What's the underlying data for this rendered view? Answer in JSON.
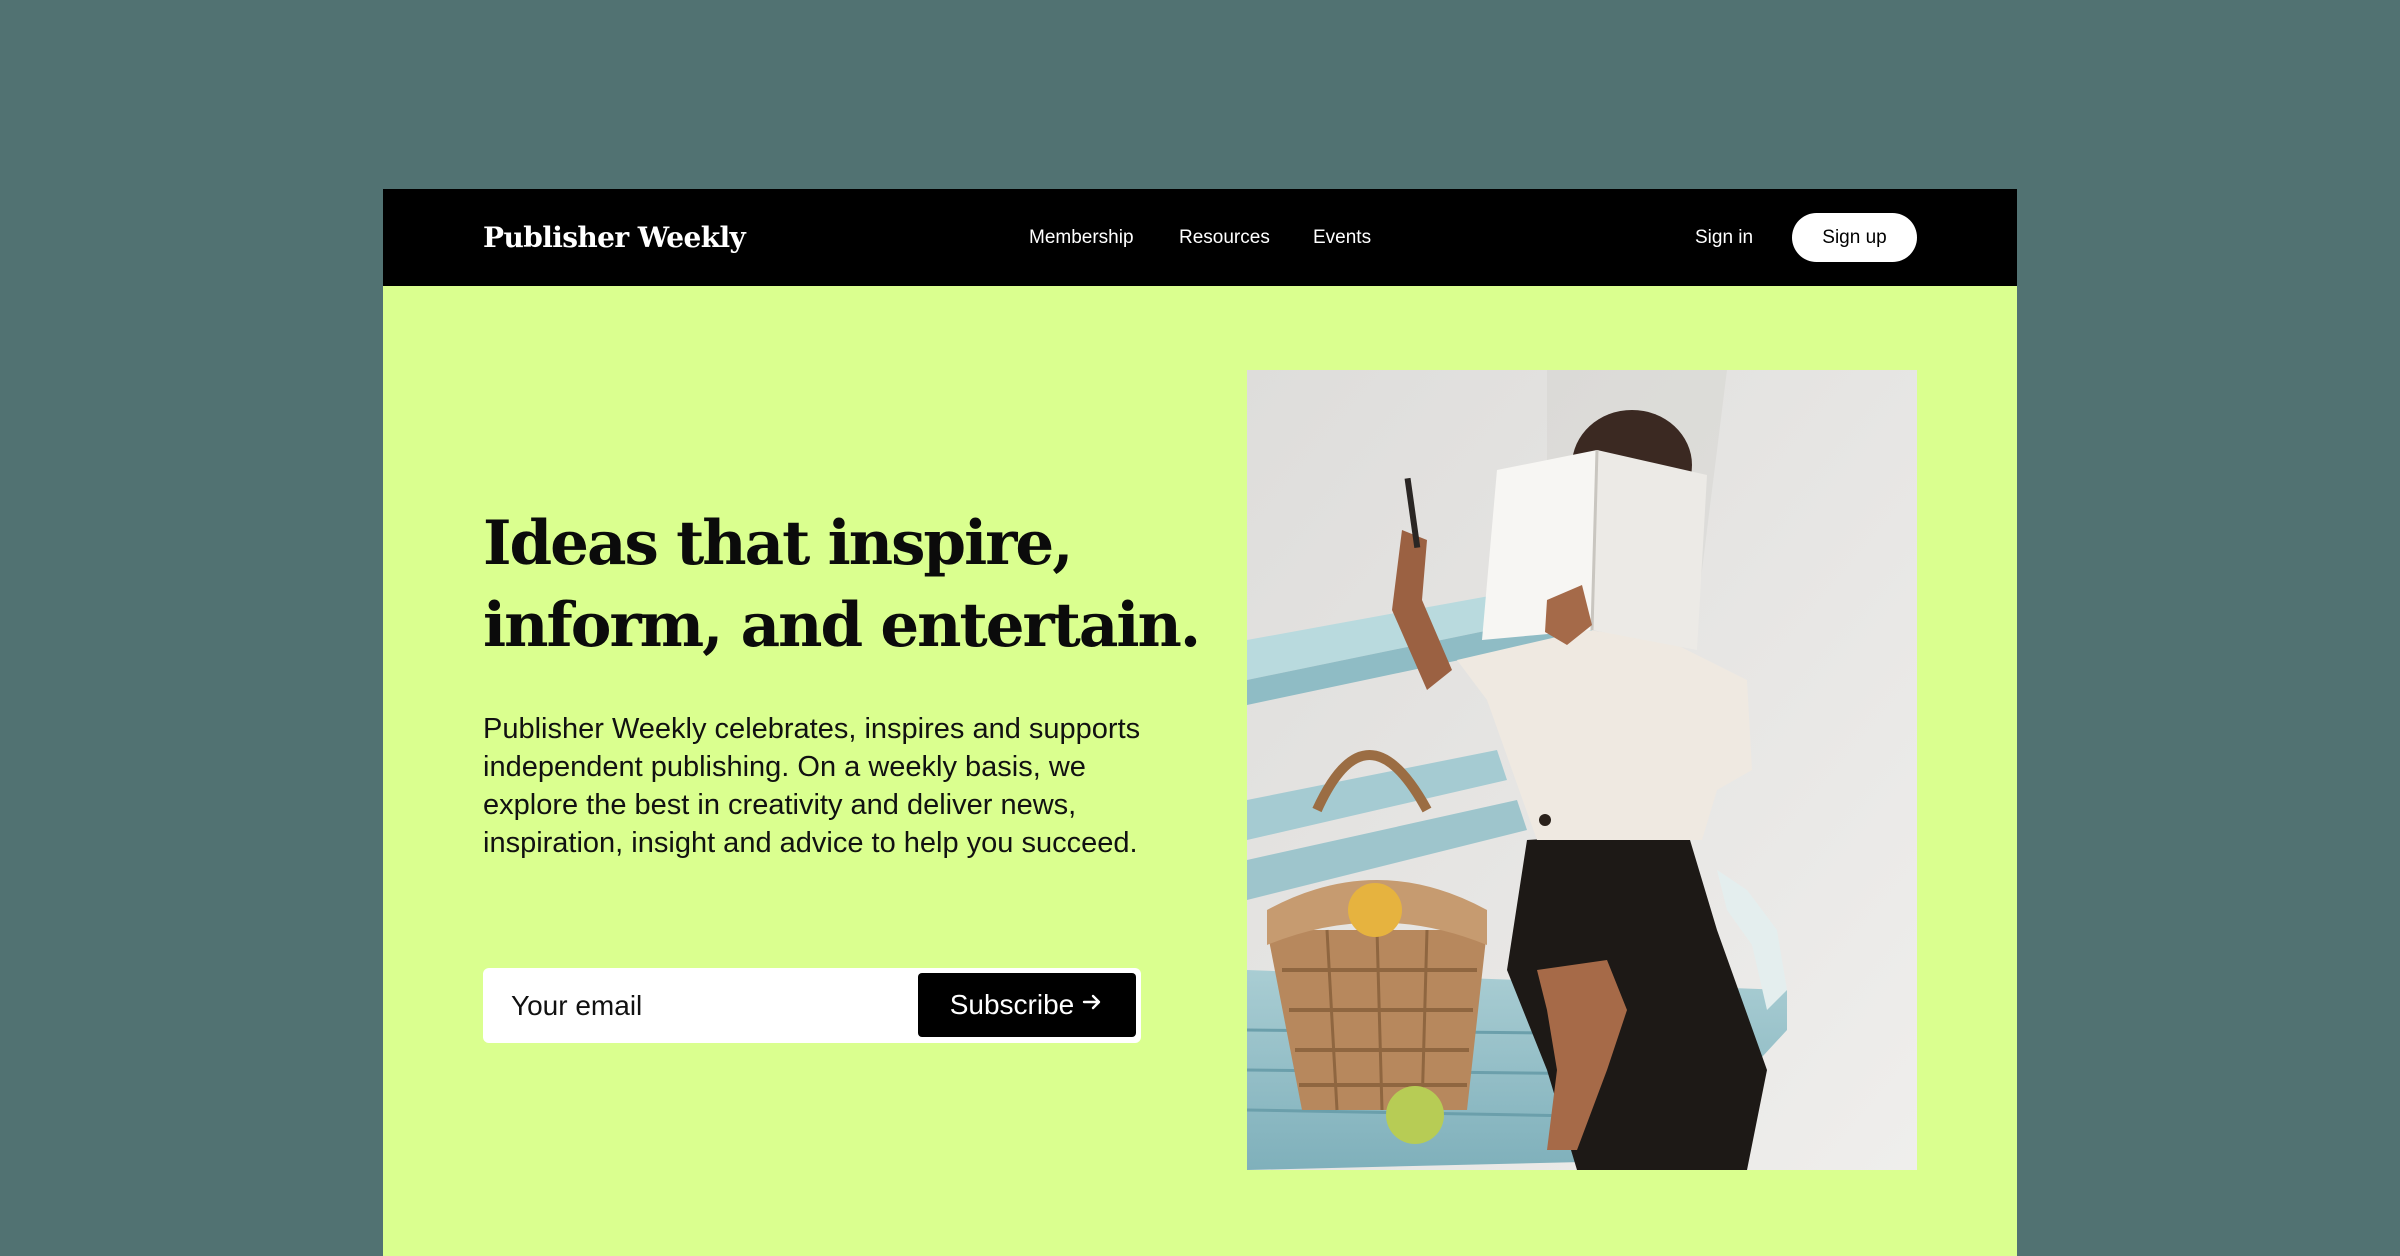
{
  "nav": {
    "logo": "Publisher Weekly",
    "links": [
      "Membership",
      "Resources",
      "Events"
    ],
    "sign_in": "Sign in",
    "sign_up": "Sign up"
  },
  "hero": {
    "title_line1": "Ideas that inspire,",
    "title_line2": "inform, and entertain.",
    "description": "Publisher Weekly celebrates, inspires and supports independent publishing. On a weekly basis, we explore the best in creativity and deliver news, inspiration, insight and advice to help you succeed.",
    "email_placeholder": "Your email",
    "subscribe_label": "Subscribe",
    "subscribe_icon": "arrow-right-icon"
  },
  "colors": {
    "page_background": "#517272",
    "hero_background": "#daff8f",
    "nav_background": "#000000"
  }
}
